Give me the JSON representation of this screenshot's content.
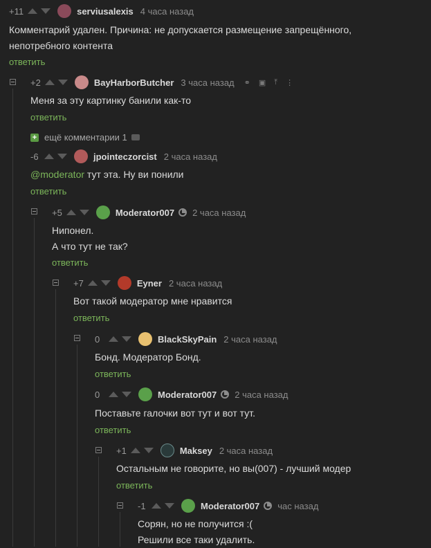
{
  "reply_label": "ответить",
  "comments": [
    {
      "rating": "+11",
      "user": "serviusalexis",
      "time": "4 часа назад",
      "lines": [
        "Комментарий удален. Причина: не допускается размещение запрещённого,",
        "непотребного контента"
      ],
      "avatar": "#8a4a5a"
    },
    {
      "rating": "+2",
      "user": "BayHarborButcher",
      "time": "3 часа назад",
      "lines": [
        "Меня за эту картинку банили как-то"
      ],
      "avatar": "#c98a8a"
    },
    {
      "rating": "-6",
      "user": "jpointeczorcist",
      "time": "2 часа назад",
      "mention": "@moderator",
      "lines": [
        " тут эта. Ну ви понили"
      ],
      "avatar": "#b15a5a"
    },
    {
      "rating": "+5",
      "user": "Moderator007",
      "time": "2 часа назад",
      "lines": [
        "Нипонел.",
        "А что тут не так?"
      ],
      "avatar": "#5aa04a"
    },
    {
      "rating": "+7",
      "user": "Eyner",
      "time": "2 часа назад",
      "lines": [
        "Вот такой модератор мне нравится"
      ],
      "avatar": "#b33a2a"
    },
    {
      "rating": "0",
      "user": "BlackSkyPain",
      "time": "2 часа назад",
      "lines": [
        "Бонд. Модератор Бонд."
      ],
      "avatar": "#e8c070"
    },
    {
      "rating": "0",
      "user": "Moderator007",
      "time": "2 часа назад",
      "lines": [
        "Поставьте галочки вот тут и вот тут."
      ],
      "avatar": "#5aa04a"
    },
    {
      "rating": "+1",
      "user": "Maksey",
      "time": "2 часа назад",
      "lines": [
        "Остальным не говорите, но вы(007) - лучший модер"
      ],
      "avatar": "#2a3a3a"
    },
    {
      "rating": "-1",
      "user": "Moderator007",
      "time": "час назад",
      "lines": [
        "Сорян, но не получится :(",
        "Решили все таки удалить."
      ],
      "avatar": "#5aa04a"
    }
  ],
  "more_comments": "ещё комментарии 1",
  "icons": [
    "link-icon",
    "save-icon",
    "upload-icon",
    "share-icon"
  ]
}
